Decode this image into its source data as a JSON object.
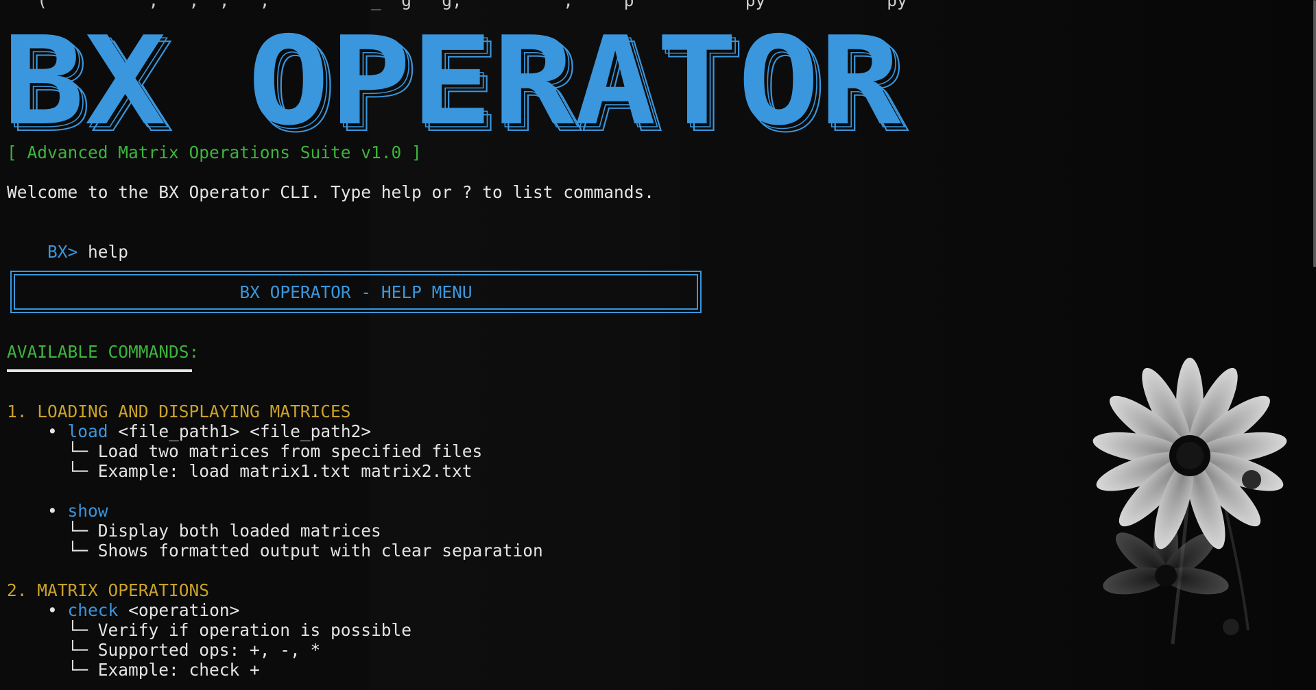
{
  "terminal": {
    "cutoff_line": "   (          ,   ,  ,   ,          _  g   g,          ,     p           py            py",
    "banner_text": "BX OPERATOR",
    "subtitle": "[ Advanced Matrix Operations Suite v1.0 ]",
    "welcome": "Welcome to the BX Operator CLI. Type help or ? to list commands.",
    "prompt": "BX>",
    "prompt_command": " help",
    "help_box_title": "BX OPERATOR - HELP MENU",
    "available_heading": "AVAILABLE COMMANDS:",
    "sections": [
      {
        "heading": "1. LOADING AND DISPLAYING MATRICES",
        "commands": [
          {
            "name": "load",
            "args": " <file_path1> <file_path2>",
            "details": [
              "Load two matrices from specified files",
              "Example: load matrix1.txt matrix2.txt"
            ]
          },
          {
            "name": "show",
            "args": "",
            "details": [
              "Display both loaded matrices",
              "Shows formatted output with clear separation"
            ]
          }
        ]
      },
      {
        "heading": "2. MATRIX OPERATIONS",
        "commands": [
          {
            "name": "check",
            "args": " <operation>",
            "details": [
              "Verify if operation is possible",
              "Supported ops: +, -, *",
              "Example: check +"
            ]
          }
        ]
      }
    ],
    "bullet": "•",
    "branch": "└─"
  },
  "colors": {
    "background": "#0c0c0c",
    "banner_blue": "#3a96dd",
    "green": "#3cb43c",
    "gold": "#c9a227",
    "text": "#e4e4e4"
  }
}
